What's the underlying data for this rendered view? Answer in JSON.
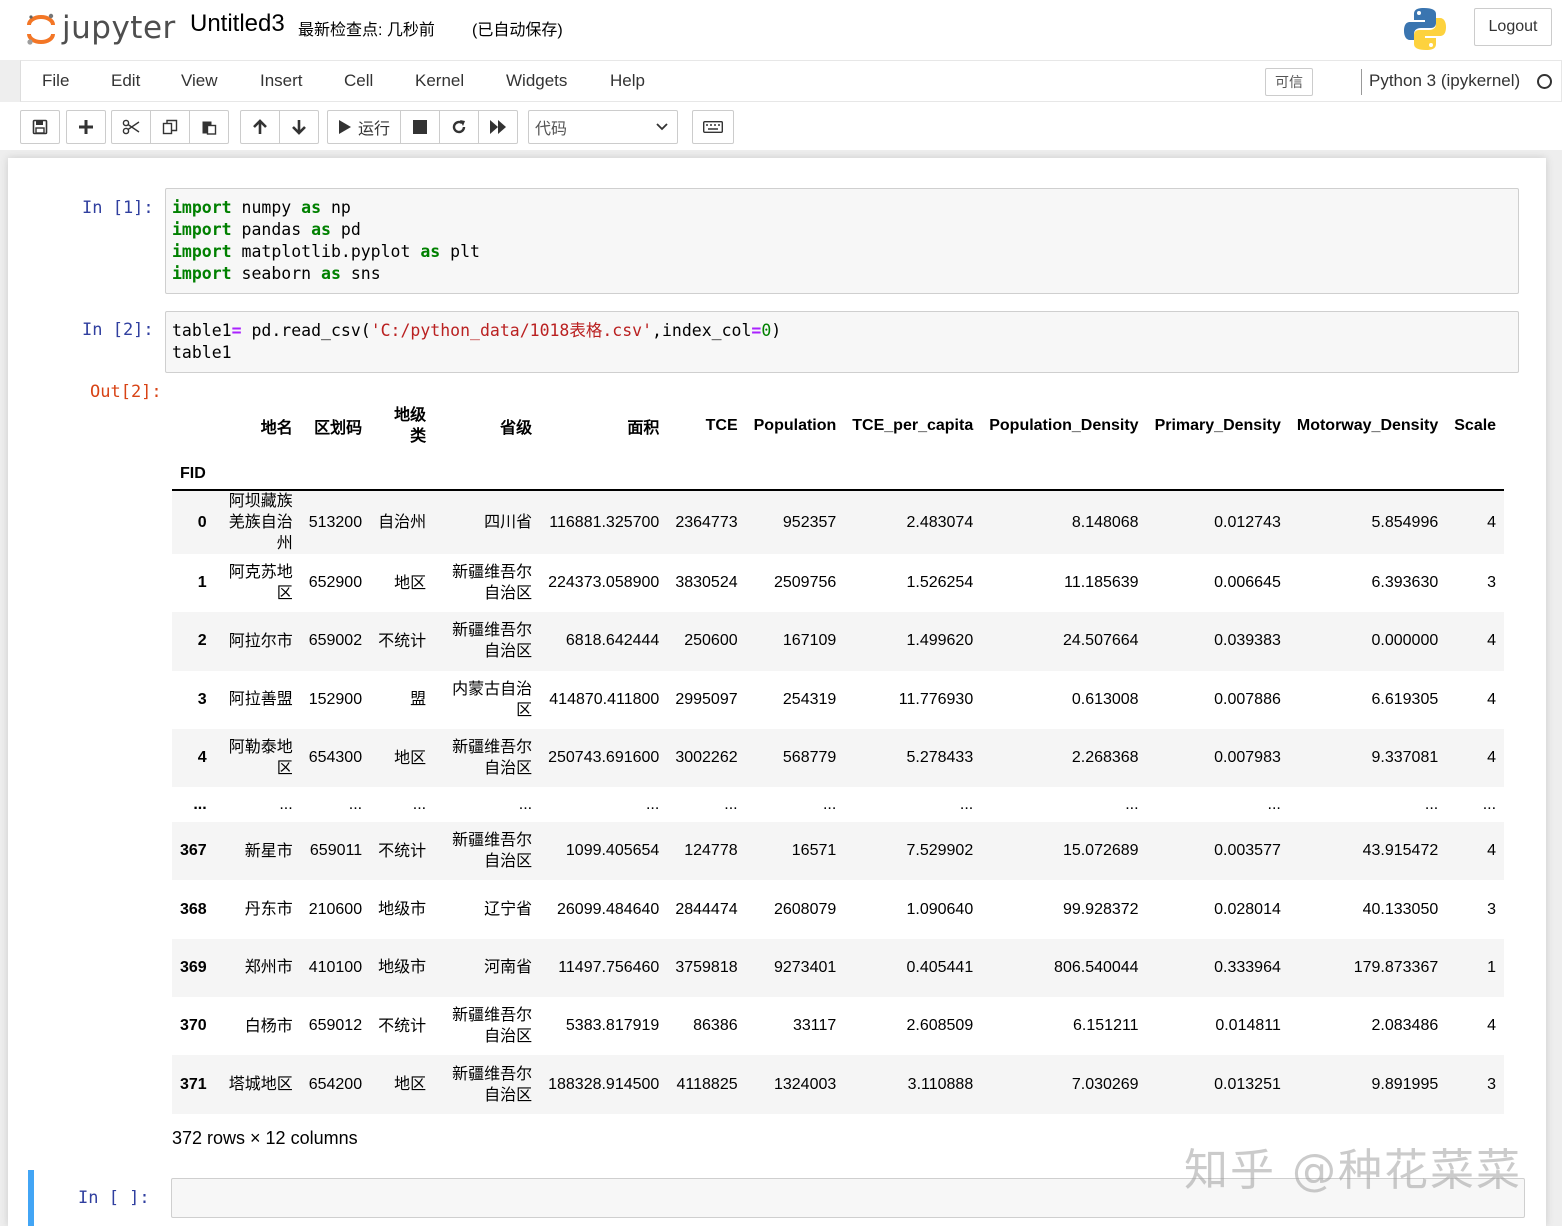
{
  "header": {
    "logo_text": "jupyter",
    "notebook_name": "Untitled3",
    "checkpoint": "最新检查点: 几秒前",
    "autosave": "(已自动保存)",
    "logout_label": "Logout"
  },
  "menubar": {
    "items": [
      "File",
      "Edit",
      "View",
      "Insert",
      "Cell",
      "Kernel",
      "Widgets",
      "Help"
    ],
    "trusted_label": "可信",
    "kernel_name": "Python 3 (ipykernel)"
  },
  "toolbar": {
    "run_label": "运行",
    "cell_type": "代码"
  },
  "cells": [
    {
      "prompt": "In  [1]:",
      "code_lines": [
        [
          "import",
          " numpy ",
          "as",
          " np"
        ],
        [
          "import",
          " pandas ",
          "as",
          " pd"
        ],
        [
          "import",
          " matplotlib.pyplot ",
          "as",
          " plt"
        ],
        [
          "import",
          " seaborn ",
          "as",
          " sns"
        ]
      ]
    },
    {
      "prompt": "In  [2]:",
      "code_line1_a": "table1",
      "code_line1_op": "=",
      "code_line1_b": " pd.read_csv(",
      "code_line1_str": "'C:/python_data/1018表格.csv'",
      "code_line1_c": ",index_col",
      "code_line1_eq": "=",
      "code_line1_num": "0",
      "code_line1_d": ")",
      "code_line2": "table1",
      "out_prompt": "Out[2]:"
    }
  ],
  "dataframe": {
    "columns": [
      "地名",
      "区划码",
      "地级类",
      "省级",
      "面积",
      "TCE",
      "Population",
      "TCE_per_capita",
      "Population_Density",
      "Primary_Density",
      "Motorway_Density",
      "Scale"
    ],
    "index_name": "FID",
    "rows": [
      {
        "fid": "0",
        "cells": [
          "阿坝藏族羌族自治州",
          "513200",
          "自治州",
          "四川省",
          "116881.325700",
          "2364773",
          "952357",
          "2.483074",
          "8.148068",
          "0.012743",
          "5.854996",
          "4"
        ]
      },
      {
        "fid": "1",
        "cells": [
          "阿克苏地区",
          "652900",
          "地区",
          "新疆维吾尔自治区",
          "224373.058900",
          "3830524",
          "2509756",
          "1.526254",
          "11.185639",
          "0.006645",
          "6.393630",
          "3"
        ]
      },
      {
        "fid": "2",
        "cells": [
          "阿拉尔市",
          "659002",
          "不统计",
          "新疆维吾尔自治区",
          "6818.642444",
          "250600",
          "167109",
          "1.499620",
          "24.507664",
          "0.039383",
          "0.000000",
          "4"
        ]
      },
      {
        "fid": "3",
        "cells": [
          "阿拉善盟",
          "152900",
          "盟",
          "内蒙古自治区",
          "414870.411800",
          "2995097",
          "254319",
          "11.776930",
          "0.613008",
          "0.007886",
          "6.619305",
          "4"
        ]
      },
      {
        "fid": "4",
        "cells": [
          "阿勒泰地区",
          "654300",
          "地区",
          "新疆维吾尔自治区",
          "250743.691600",
          "3002262",
          "568779",
          "5.278433",
          "2.268368",
          "0.007983",
          "9.337081",
          "4"
        ]
      },
      {
        "fid": "...",
        "cells": [
          "...",
          "...",
          "...",
          "...",
          "...",
          "...",
          "...",
          "...",
          "...",
          "...",
          "...",
          "..."
        ]
      },
      {
        "fid": "367",
        "cells": [
          "新星市",
          "659011",
          "不统计",
          "新疆维吾尔自治区",
          "1099.405654",
          "124778",
          "16571",
          "7.529902",
          "15.072689",
          "0.003577",
          "43.915472",
          "4"
        ]
      },
      {
        "fid": "368",
        "cells": [
          "丹东市",
          "210600",
          "地级市",
          "辽宁省",
          "26099.484640",
          "2844474",
          "2608079",
          "1.090640",
          "99.928372",
          "0.028014",
          "40.133050",
          "3"
        ]
      },
      {
        "fid": "369",
        "cells": [
          "郑州市",
          "410100",
          "地级市",
          "河南省",
          "11497.756460",
          "3759818",
          "9273401",
          "0.405441",
          "806.540044",
          "0.333964",
          "179.873367",
          "1"
        ]
      },
      {
        "fid": "370",
        "cells": [
          "白杨市",
          "659012",
          "不统计",
          "新疆维吾尔自治区",
          "5383.817919",
          "86386",
          "33117",
          "2.608509",
          "6.151211",
          "0.014811",
          "2.083486",
          "4"
        ]
      },
      {
        "fid": "371",
        "cells": [
          "塔城地区",
          "654200",
          "地区",
          "新疆维吾尔自治区",
          "188328.914500",
          "4118825",
          "1324003",
          "3.110888",
          "7.030269",
          "0.013251",
          "9.891995",
          "3"
        ]
      }
    ],
    "shape": "372 rows × 12 columns"
  },
  "empty_cell_prompt": "In  [ ]:",
  "watermark": "知乎 @种花菜菜"
}
